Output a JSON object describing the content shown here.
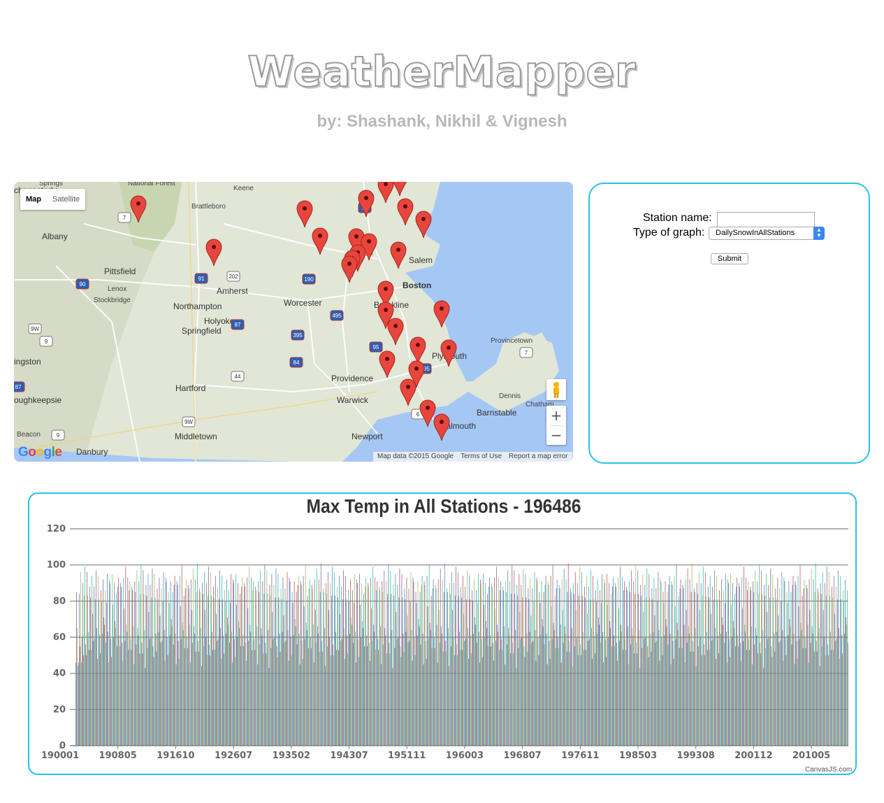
{
  "header": {
    "title": "WeatherMapper",
    "subtitle": "by: Shashank, Nikhil & Vignesh"
  },
  "map": {
    "type_buttons": [
      "Map",
      "Satellite"
    ],
    "active_type": "Map",
    "logo": "Google",
    "footer": [
      "Map data ©2015 Google",
      "Terms of Use",
      "Report a map error"
    ],
    "zoom_in": "+",
    "zoom_out": "−",
    "place_labels": [
      "Springs",
      "National Forest",
      "Keene",
      "Brattleboro",
      "Albany",
      "Pittsfield",
      "Lenox",
      "Stockbridge",
      "Northampton",
      "Amherst",
      "Holyoke",
      "Springfield",
      "Worcester",
      "Boston",
      "Brookline",
      "Salem",
      "Hartford",
      "Providence",
      "Warwick",
      "Plymouth",
      "Provincetown",
      "Dennis",
      "Chatham",
      "Barnstable",
      "Falmouth",
      "Newport",
      "Middletown",
      "Danbury",
      "Beacon",
      "oughkeepsie",
      "ingston",
      "chenectady"
    ],
    "highway_labels": [
      "7",
      "9W",
      "9",
      "87",
      "202",
      "91",
      "90",
      "93",
      "3",
      "95",
      "495",
      "190",
      "395",
      "84",
      "44",
      "195",
      "6"
    ],
    "marker_count": 26,
    "colors": {
      "water": "#a5c7f4",
      "land": "#e1e6d6",
      "marker": "#e8453c"
    }
  },
  "form": {
    "station_label": "Station name:",
    "station_value": "",
    "graph_label": "Type of graph:",
    "graph_selected": "DailySnowInAllStations",
    "submit_label": "Submit"
  },
  "chart_data": {
    "type": "bar",
    "title": "Max Temp in All Stations - 196486",
    "xlabel": "",
    "ylabel": "",
    "ylim": [
      0,
      120
    ],
    "y_ticks": [
      0,
      20,
      40,
      60,
      80,
      100,
      120
    ],
    "x_tick_labels": [
      "190001",
      "190805",
      "191610",
      "192607",
      "193502",
      "194307",
      "195111",
      "196003",
      "196807",
      "197611",
      "198503",
      "199308",
      "200112",
      "201005"
    ],
    "grid": true,
    "series_colors": [
      "#4f81bc",
      "#c0504e",
      "#9bbb58",
      "#23bfaa",
      "#8064a1"
    ],
    "bar_pattern": [
      92,
      86,
      62,
      48,
      90,
      80,
      58,
      95,
      70,
      62,
      88,
      55,
      84,
      96,
      60,
      50
    ],
    "bar_count": 1100,
    "credit": "CanvasJS.com"
  }
}
